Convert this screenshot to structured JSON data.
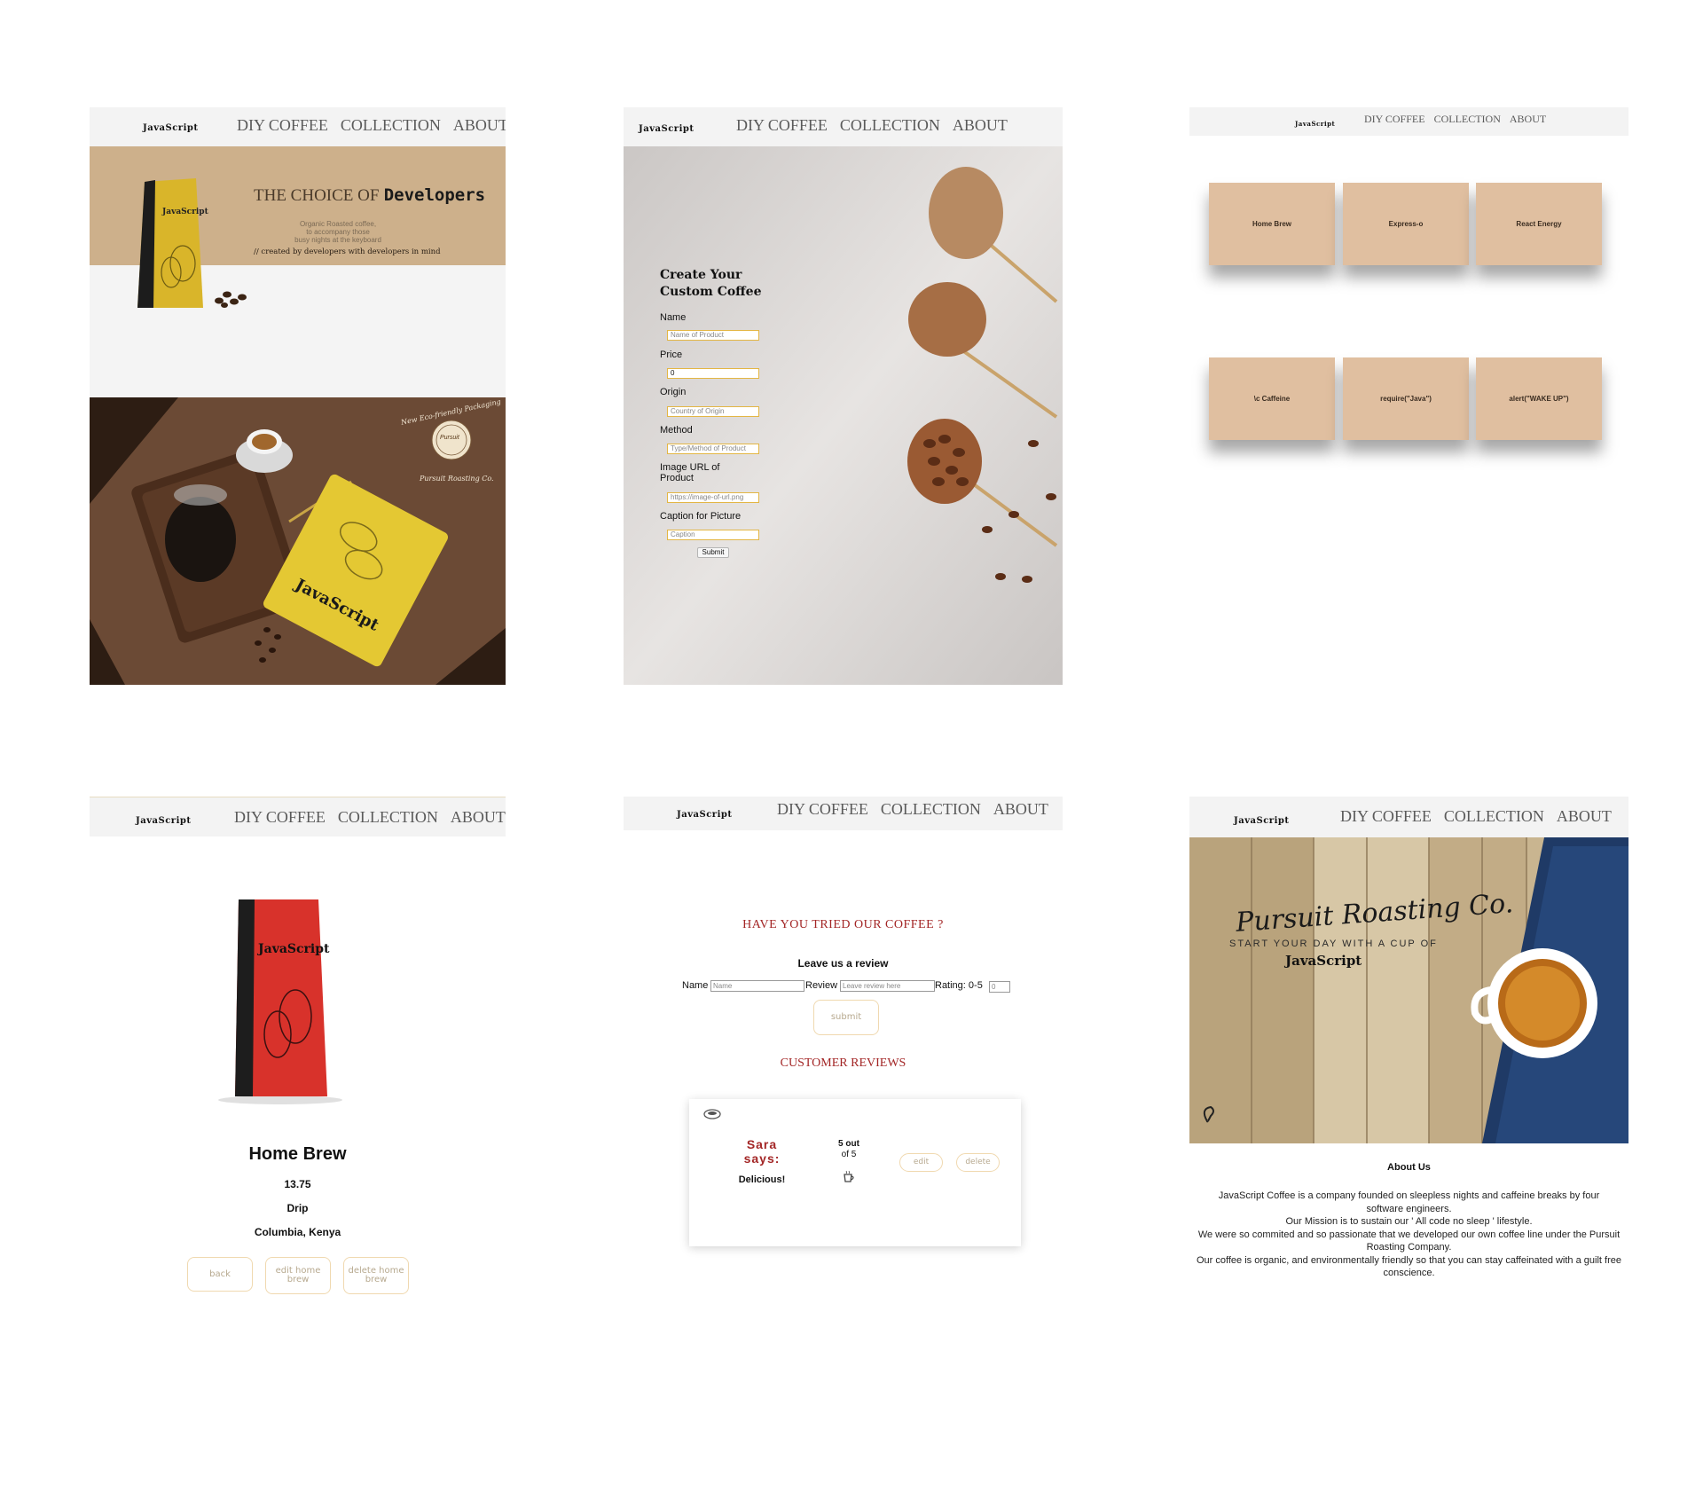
{
  "nav": {
    "logo": "JavaScript",
    "links": [
      "DIY COFFEE",
      "COLLECTION",
      "ABOUT"
    ]
  },
  "home": {
    "hero_title_prefix": "THE CHOICE OF",
    "hero_title_emph": "Developers",
    "hero_lines": [
      "Organic Roasted coffee,",
      "to accompany those",
      "busy nights at the keyboard"
    ],
    "hero_comment": "// created by developers with developers in mind",
    "bag_label": "JavaScript",
    "packaging_script": "New Eco-friendly Packaging",
    "seal_text": "Pursuit",
    "roaster_script": "Pursuit Roasting Co.",
    "colors": {
      "hero_bg": "#cdb08b",
      "bag": "#d9b52a",
      "table": "#5a3a26"
    }
  },
  "form": {
    "title_line1": "Create Your",
    "title_line2": "Custom Coffee",
    "fields": [
      {
        "label": "Name",
        "placeholder": "Name of Product"
      },
      {
        "label": "Price",
        "placeholder": "0"
      },
      {
        "label": "Origin",
        "placeholder": "Country of Origin"
      },
      {
        "label": "Method",
        "placeholder": "Type/Method of Product"
      },
      {
        "label": "Image URL of Product",
        "placeholder": "https://image-of-url.png"
      },
      {
        "label": "Caption for Picture",
        "placeholder": "Caption"
      }
    ],
    "submit_label": "Submit"
  },
  "collection": {
    "items": [
      "Home Brew",
      "Express-o",
      "React Energy",
      "\\c Caffeine",
      "require(\"Java\")",
      "alert(\"WAKE UP\")"
    ]
  },
  "detail": {
    "name": "Home Brew",
    "price": "13.75",
    "method": "Drip",
    "origin": "Columbia, Kenya",
    "buttons": [
      "back",
      "edit home brew",
      "delete home brew"
    ],
    "bag_label": "JavaScript"
  },
  "reviews": {
    "heading": "HAVE YOU TRIED OUR COFFEE ?",
    "subheading": "Leave us a review",
    "name_label": "Name",
    "name_placeholder": "Name",
    "review_label": "Review",
    "review_placeholder": "Leave review here",
    "rating_label": "Rating: 0-5",
    "rating_value": "0",
    "submit_label": "submit",
    "customer_heading": "CUSTOMER REVIEWS",
    "card": {
      "name": "Sara",
      "says": "says:",
      "text": "Delicious!",
      "rating_line1": "5 out",
      "rating_line2": "of 5",
      "edit_label": "edit",
      "delete_label": "delete"
    }
  },
  "about": {
    "hero_script": "Pursuit Roasting Co.",
    "hero_tagline": "START YOUR DAY WITH A CUP OF",
    "hero_brand": "JavaScript",
    "title": "About Us",
    "paragraphs": [
      "JavaScript Coffee is a company founded on sleepless nights and caffeine breaks by four software engineers.",
      "Our Mission is to sustain our ' All code no sleep ' lifestyle.",
      "We were so commited and so passionate that we developed our own coffee line under the Pursuit Roasting Company.",
      "Our coffee is organic, and environmentally friendly so that you can stay caffeinated with a guilt free conscience."
    ]
  },
  "accent": {
    "red": "#a32626",
    "peach": "#f0d9b0"
  }
}
